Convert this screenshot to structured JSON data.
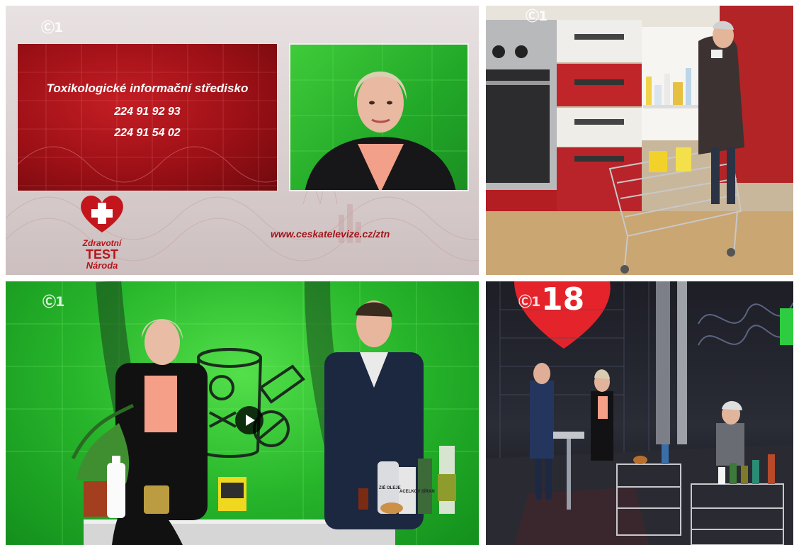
{
  "tiles": {
    "tile1": {
      "channel_logo": "Ⓒ1",
      "info_card": {
        "title": "Toxikologické informační středisko",
        "phone_1": "224 91 92 93",
        "phone_2": "224 91 54 02"
      },
      "website": "www.ceskatelevize.cz/ztn",
      "brand": {
        "line1": "Zdravotní",
        "line2": "TEST",
        "line3": "Národa"
      }
    },
    "tile2": {
      "channel_logo": "Ⓒ1"
    },
    "tile3": {
      "channel_logo": "Ⓒ1",
      "bottle_label_1": "ZIÉ OLEJE",
      "bottle_label_2": "ACELKOV SÍRAN"
    },
    "tile4": {
      "channel_logo": "Ⓒ1",
      "counter": "18"
    }
  },
  "icons": {
    "play": "play-icon",
    "heart_cross": "heart-cross-icon",
    "poison_can": "poison-can-icon"
  },
  "colors": {
    "brand_red": "#b5151b",
    "card_red": "#9c1016",
    "screen_green": "#27b52b",
    "studio_dark": "#1d1e26"
  }
}
